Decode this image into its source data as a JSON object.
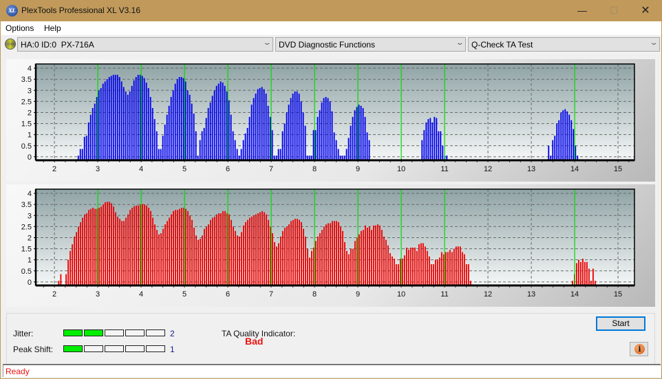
{
  "window": {
    "title": "PlexTools Professional XL V3.16",
    "icon": "xl-logo-icon",
    "controls": {
      "minimize": "—",
      "maximize": "☐",
      "close": "✕"
    }
  },
  "menu": {
    "items": [
      {
        "label": "Options"
      },
      {
        "label": "Help"
      }
    ]
  },
  "toolbar": {
    "drive": {
      "value": "HA:0 ID:0  PX-716A",
      "icon": "disc-icon"
    },
    "function": {
      "value": "DVD Diagnostic Functions"
    },
    "test": {
      "value": "Q-Check TA Test"
    }
  },
  "colors": {
    "top_bars": "#0000ee",
    "bottom_bars": "#ee0000",
    "marker_lines": "#00dd00",
    "meter_on": "#00ee00",
    "quality_bad": "#ee1111",
    "status_text": "#ee1111"
  },
  "chart_data": [
    {
      "type": "bar",
      "name": "TA histogram (top)",
      "series_color": "#0000ee",
      "xlim": [
        1.57,
        15.38
      ],
      "ylim": [
        -0.16,
        4.19
      ],
      "x_ticks": [
        "2",
        "3",
        "4",
        "5",
        "6",
        "7",
        "8",
        "9",
        "10",
        "11",
        "12",
        "13",
        "14",
        "15"
      ],
      "y_ticks": [
        "0",
        "0.5",
        "1",
        "1.5",
        "2",
        "2.5",
        "3",
        "3.5",
        "4"
      ],
      "grid": true,
      "marker_lines_x": [
        3,
        4,
        5,
        6,
        7,
        8,
        9,
        10,
        11,
        14
      ],
      "bar_step": 0.0476,
      "segments": [
        {
          "x_start": 2.55,
          "values": [
            0.05,
            0.35,
            0.35,
            0.9,
            0.95,
            1.55,
            1.9,
            2.2,
            2.4,
            2.7,
            3.0,
            3.1,
            3.3,
            3.4,
            3.5,
            3.6,
            3.65,
            3.7,
            3.7,
            3.7,
            3.6,
            3.4,
            3.15,
            2.95,
            2.8,
            2.95,
            3.2,
            3.45,
            3.6,
            3.7,
            3.7,
            3.65,
            3.55,
            3.35,
            3.1,
            2.7,
            2.2,
            1.7,
            1.15,
            0.35,
            0.35,
            0.95,
            1.45,
            1.9,
            2.3,
            2.7,
            3.0,
            3.3,
            3.5,
            3.6,
            3.6,
            3.55,
            3.4,
            3.0,
            2.8,
            2.4,
            1.95,
            1.15,
            0.05,
            0.75,
            1.15,
            1.3,
            1.75,
            2.2,
            2.45,
            2.75,
            3.0,
            3.2,
            3.3,
            3.4,
            3.35,
            3.2,
            2.95,
            2.55,
            1.9,
            1.15,
            0.75,
            0.35,
            0.05,
            0.35,
            0.75,
            1.05,
            1.3,
            1.8,
            2.35,
            2.65,
            2.85,
            3.05,
            3.1,
            3.15,
            3.05,
            2.85,
            2.3,
            1.8,
            1.2,
            0.05,
            0.05,
            0.35,
            0.35,
            1.15,
            1.5,
            2.0,
            2.35,
            2.65,
            2.85,
            2.95,
            2.95,
            2.85,
            2.5,
            2.0,
            1.4,
            0.05,
            0.05,
            0.05,
            1.2,
            1.2,
            1.8,
            2.1,
            2.45,
            2.65,
            2.7,
            2.65,
            2.5,
            2.05,
            1.1,
            0.75,
            0.35,
            0.05,
            0.05,
            0.05,
            0.35,
            0.85,
            1.4,
            1.8,
            2.1,
            2.25,
            2.35,
            2.3,
            2.2,
            1.8,
            1.1,
            0.75
          ]
        },
        {
          "x_start": 10.48,
          "values": [
            0.75,
            1.2,
            1.55,
            1.7,
            1.75,
            1.55,
            1.8,
            1.75,
            1.15,
            1.15,
            0.5,
            0.05,
            0.05
          ]
        },
        {
          "x_start": 13.4,
          "values": [
            0.5,
            0.05,
            0.75,
            0.95,
            1.5,
            1.65,
            2.0,
            2.1,
            2.15,
            2.05,
            1.9,
            1.65,
            1.25,
            0.5,
            0.05
          ]
        }
      ]
    },
    {
      "type": "bar",
      "name": "TA histogram (bottom)",
      "series_color": "#ee0000",
      "xlim": [
        1.57,
        15.38
      ],
      "ylim": [
        -0.16,
        4.19
      ],
      "x_ticks": [
        "2",
        "3",
        "4",
        "5",
        "6",
        "7",
        "8",
        "9",
        "10",
        "11",
        "12",
        "13",
        "14",
        "15"
      ],
      "y_ticks": [
        "0",
        "0.5",
        "1",
        "1.5",
        "2",
        "2.5",
        "3",
        "3.5",
        "4"
      ],
      "grid": true,
      "marker_lines_x": [
        3,
        4,
        5,
        6,
        7,
        8,
        9,
        10,
        11,
        14
      ],
      "bar_step": 0.0476,
      "segments": [
        {
          "x_start": 2.1,
          "values": [
            0.05,
            0.35
          ]
        },
        {
          "x_start": 2.27,
          "values": [
            0.35,
            1.0,
            1.4,
            1.7,
            2.05,
            2.25,
            2.5,
            2.7,
            2.9,
            3.05,
            3.1,
            3.25,
            3.3,
            3.35,
            3.3,
            3.3,
            3.35,
            3.4,
            3.5,
            3.6,
            3.62,
            3.62,
            3.55,
            3.4,
            3.15,
            2.95,
            2.85,
            2.75,
            2.75,
            2.9,
            3.05,
            3.25,
            3.35,
            3.42,
            3.45,
            3.45,
            3.5,
            3.52,
            3.5,
            3.45,
            3.35,
            3.2,
            2.9,
            2.6,
            2.35,
            2.15,
            2.2,
            2.4,
            2.6,
            2.75,
            2.9,
            3.05,
            3.2,
            3.25,
            3.25,
            3.3,
            3.35,
            3.35,
            3.3,
            3.2,
            3.0,
            2.8,
            2.45,
            2.1,
            1.9,
            1.95,
            2.1,
            2.4,
            2.5,
            2.6,
            2.8,
            2.9,
            2.95,
            3.05,
            3.1,
            3.1,
            3.2,
            3.2,
            3.1,
            3.05,
            2.8,
            2.5,
            2.3,
            2.1,
            2.05,
            2.25,
            2.55,
            2.7,
            2.8,
            2.9,
            2.95,
            3.0,
            3.05,
            3.1,
            3.15,
            3.2,
            3.15,
            3.05,
            2.8,
            2.5,
            2.2,
            1.8,
            1.6,
            1.75,
            2.05,
            2.3,
            2.45,
            2.5,
            2.6,
            2.75,
            2.8,
            2.85,
            2.85,
            2.8,
            2.7,
            2.4,
            2.05,
            1.5,
            1.1,
            1.4,
            1.55,
            1.85,
            2.05,
            2.2,
            2.35,
            2.5,
            2.6,
            2.65,
            2.65,
            2.75,
            2.75,
            2.75,
            2.7,
            2.5,
            2.3,
            1.8,
            1.4,
            1.25,
            1.5,
            1.5,
            1.85,
            2.0,
            2.15,
            2.3,
            2.35,
            2.55,
            2.45,
            2.5,
            2.35,
            2.55,
            2.55,
            2.6,
            2.55,
            2.35,
            2.05,
            1.9,
            1.65,
            1.3,
            1.15,
            1.05,
            0.8,
            0.8,
            1.05,
            1.05,
            1.2,
            1.55,
            1.45,
            1.55,
            1.55,
            1.55,
            1.4,
            1.7,
            1.75,
            1.75,
            1.6,
            1.4,
            1.15,
            0.8,
            0.8,
            1.0,
            1.0,
            1.1,
            1.35,
            1.25,
            1.35,
            1.35,
            1.45,
            1.35,
            1.5,
            1.6,
            1.6,
            1.6,
            1.35,
            1.25,
            0.8,
            0.8,
            0.05
          ]
        },
        {
          "x_start": 13.95,
          "values": [
            0.05,
            0.35,
            0.85,
            1.0,
            0.9,
            1.05,
            0.9,
            0.9,
            0.6,
            0.05,
            0.6,
            0.05
          ]
        }
      ]
    }
  ],
  "results": {
    "jitter": {
      "label": "Jitter:",
      "value": "2",
      "level": 2,
      "max": 5
    },
    "peak_shift": {
      "label": "Peak Shift:",
      "value": "1",
      "level": 1,
      "max": 5
    },
    "ta_quality": {
      "label": "TA Quality Indicator:",
      "value": "Bad"
    }
  },
  "buttons": {
    "start": "Start",
    "info": "i"
  },
  "status": {
    "text": "Ready"
  }
}
